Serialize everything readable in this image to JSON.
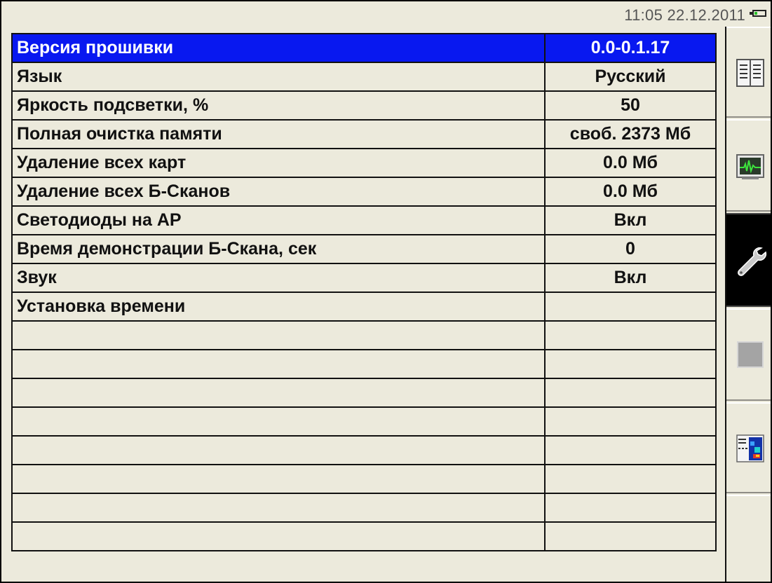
{
  "status": {
    "clock": "11:05 22.12.2011",
    "battery_color": "#29C029"
  },
  "colors": {
    "background": "#ECEADC",
    "selection": "#0818F0"
  },
  "settings": [
    {
      "label": "Версия прошивки",
      "value": "0.0-0.1.17",
      "selected": true
    },
    {
      "label": "Язык",
      "value": "Русский"
    },
    {
      "label": "Яркость подсветки, %",
      "value": "50"
    },
    {
      "label": "Полная очистка памяти",
      "value": "своб. 2373 Мб"
    },
    {
      "label": "Удаление всех карт",
      "value": "0.0 Мб"
    },
    {
      "label": "Удаление всех Б-Сканов",
      "value": "0.0 Мб"
    },
    {
      "label": "Светодиоды на АР",
      "value": "Вкл"
    },
    {
      "label": "Время демонстрации Б-Скана, сек",
      "value": "0"
    },
    {
      "label": "Звук",
      "value": "Вкл"
    },
    {
      "label": "Установка времени",
      "value": ""
    },
    {
      "label": "",
      "value": ""
    },
    {
      "label": "",
      "value": ""
    },
    {
      "label": "",
      "value": ""
    },
    {
      "label": "",
      "value": ""
    },
    {
      "label": "",
      "value": ""
    },
    {
      "label": "",
      "value": ""
    },
    {
      "label": "",
      "value": ""
    },
    {
      "label": "",
      "value": ""
    }
  ],
  "side_buttons": [
    {
      "icon": "document-icon",
      "active": false
    },
    {
      "icon": "monitor-waveform-icon",
      "active": false
    },
    {
      "icon": "wrench-icon",
      "active": true
    },
    {
      "icon": "gray-square-icon",
      "active": false
    },
    {
      "icon": "bscan-report-icon",
      "active": false
    },
    {
      "icon": "empty-slot",
      "active": false
    }
  ]
}
